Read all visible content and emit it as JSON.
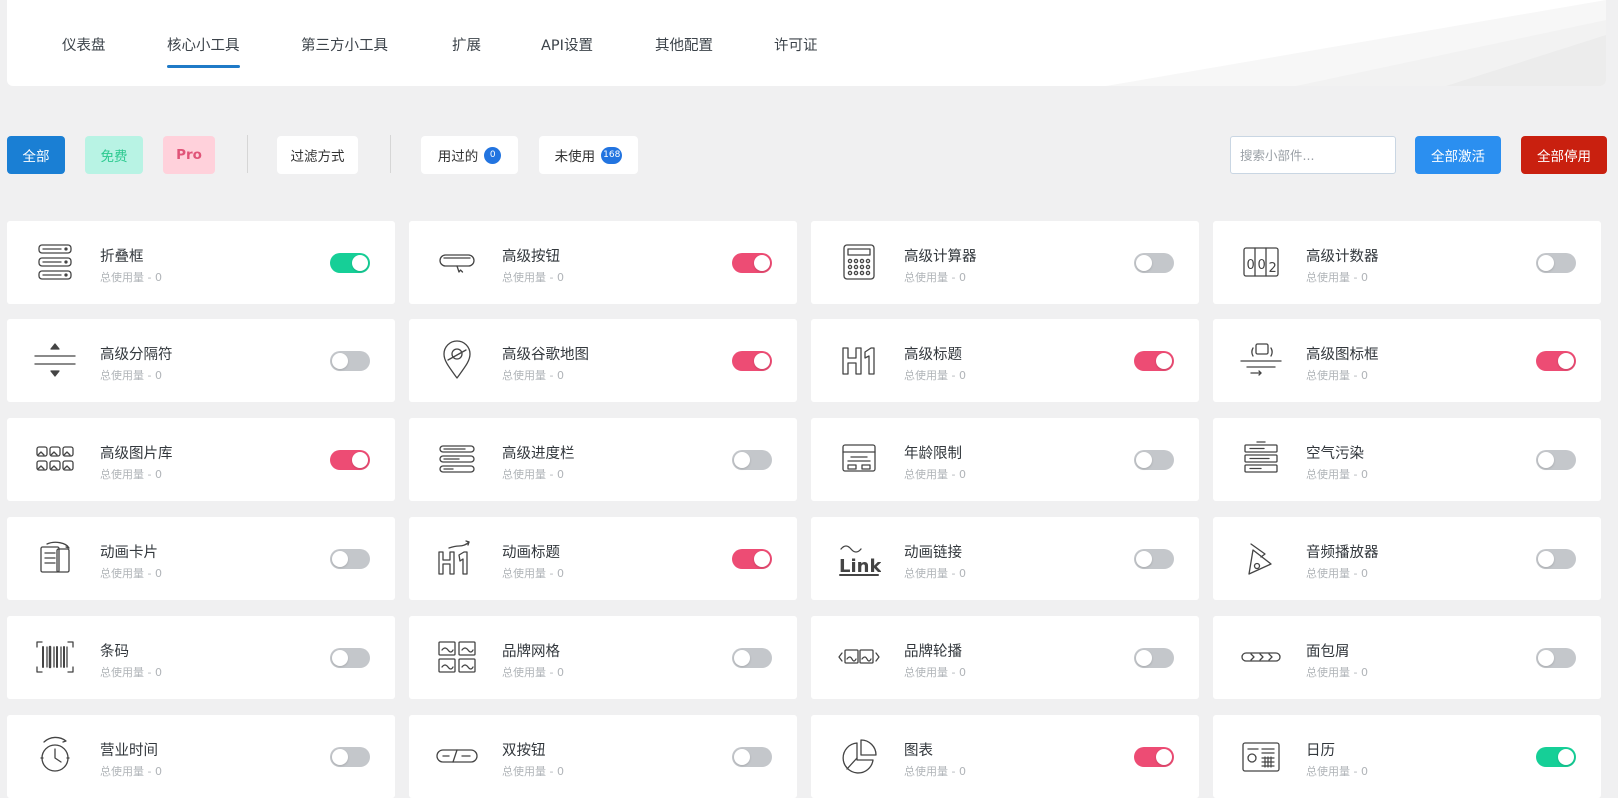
{
  "nav": {
    "tabs": [
      {
        "label": "仪表盘"
      },
      {
        "label": "核心小工具"
      },
      {
        "label": "第三方小工具"
      },
      {
        "label": "扩展"
      },
      {
        "label": "API设置"
      },
      {
        "label": "其他配置"
      },
      {
        "label": "许可证"
      }
    ],
    "active_tab": "核心小工具"
  },
  "filters": {
    "all_label": "全部",
    "free_label": "免费",
    "pro_label": "Pro",
    "filter_by_label": "过滤方式",
    "used_label": "用过的",
    "used_count": "0",
    "unused_label": "未使用",
    "unused_count": "168"
  },
  "search": {
    "placeholder": "搜索小部件..."
  },
  "actions": {
    "activate_all": "全部激活",
    "deactivate_all": "全部停用"
  },
  "colors": {
    "primary": "#1a7fd4",
    "toggle_green": "#16cf97",
    "toggle_pink": "#ed4c74",
    "toggle_off": "#c4c7cb",
    "danger": "#c9200f"
  },
  "widgets": [
    {
      "name": "折叠框",
      "usage": "总使用量 - 0",
      "icon": "accordion-icon",
      "enabled": true,
      "toggle_color": "green"
    },
    {
      "name": "高级按钮",
      "usage": "总使用量 - 0",
      "icon": "button-icon",
      "enabled": true,
      "toggle_color": "pink"
    },
    {
      "name": "高级计算器",
      "usage": "总使用量 - 0",
      "icon": "calculator-icon",
      "enabled": false,
      "toggle_color": "off"
    },
    {
      "name": "高级计数器",
      "usage": "总使用量 - 0",
      "icon": "counter-icon",
      "enabled": false,
      "toggle_color": "off"
    },
    {
      "name": "高级分隔符",
      "usage": "总使用量 - 0",
      "icon": "divider-icon",
      "enabled": false,
      "toggle_color": "off"
    },
    {
      "name": "高级谷歌地图",
      "usage": "总使用量 - 0",
      "icon": "map-pin-icon",
      "enabled": true,
      "toggle_color": "pink"
    },
    {
      "name": "高级标题",
      "usage": "总使用量 - 0",
      "icon": "heading-icon",
      "enabled": true,
      "toggle_color": "pink"
    },
    {
      "name": "高级图标框",
      "usage": "总使用量 - 0",
      "icon": "icon-box-icon",
      "enabled": true,
      "toggle_color": "pink"
    },
    {
      "name": "高级图片库",
      "usage": "总使用量 - 0",
      "icon": "gallery-icon",
      "enabled": true,
      "toggle_color": "pink"
    },
    {
      "name": "高级进度栏",
      "usage": "总使用量 - 0",
      "icon": "progress-bar-icon",
      "enabled": false,
      "toggle_color": "off"
    },
    {
      "name": "年龄限制",
      "usage": "总使用量 - 0",
      "icon": "age-gate-icon",
      "enabled": false,
      "toggle_color": "off"
    },
    {
      "name": "空气污染",
      "usage": "总使用量 - 0",
      "icon": "air-pollution-icon",
      "enabled": false,
      "toggle_color": "off"
    },
    {
      "name": "动画卡片",
      "usage": "总使用量 - 0",
      "icon": "flip-card-icon",
      "enabled": false,
      "toggle_color": "off"
    },
    {
      "name": "动画标题",
      "usage": "总使用量 - 0",
      "icon": "animated-heading-icon",
      "enabled": true,
      "toggle_color": "pink"
    },
    {
      "name": "动画链接",
      "usage": "总使用量 - 0",
      "icon": "animated-link-icon",
      "enabled": false,
      "toggle_color": "off"
    },
    {
      "name": "音频播放器",
      "usage": "总使用量 - 0",
      "icon": "audio-player-icon",
      "enabled": false,
      "toggle_color": "off"
    },
    {
      "name": "条码",
      "usage": "总使用量 - 0",
      "icon": "barcode-icon",
      "enabled": false,
      "toggle_color": "off"
    },
    {
      "name": "品牌网格",
      "usage": "总使用量 - 0",
      "icon": "brand-grid-icon",
      "enabled": false,
      "toggle_color": "off"
    },
    {
      "name": "品牌轮播",
      "usage": "总使用量 - 0",
      "icon": "brand-carousel-icon",
      "enabled": false,
      "toggle_color": "off"
    },
    {
      "name": "面包屑",
      "usage": "总使用量 - 0",
      "icon": "breadcrumbs-icon",
      "enabled": false,
      "toggle_color": "off"
    },
    {
      "name": "营业时间",
      "usage": "总使用量 - 0",
      "icon": "clock-icon",
      "enabled": false,
      "toggle_color": "off"
    },
    {
      "name": "双按钮",
      "usage": "总使用量 - 0",
      "icon": "dual-button-icon",
      "enabled": false,
      "toggle_color": "off"
    },
    {
      "name": "图表",
      "usage": "总使用量 - 0",
      "icon": "pie-chart-icon",
      "enabled": true,
      "toggle_color": "pink"
    },
    {
      "name": "日历",
      "usage": "总使用量 - 0",
      "icon": "calendar-icon",
      "enabled": true,
      "toggle_color": "green"
    }
  ]
}
